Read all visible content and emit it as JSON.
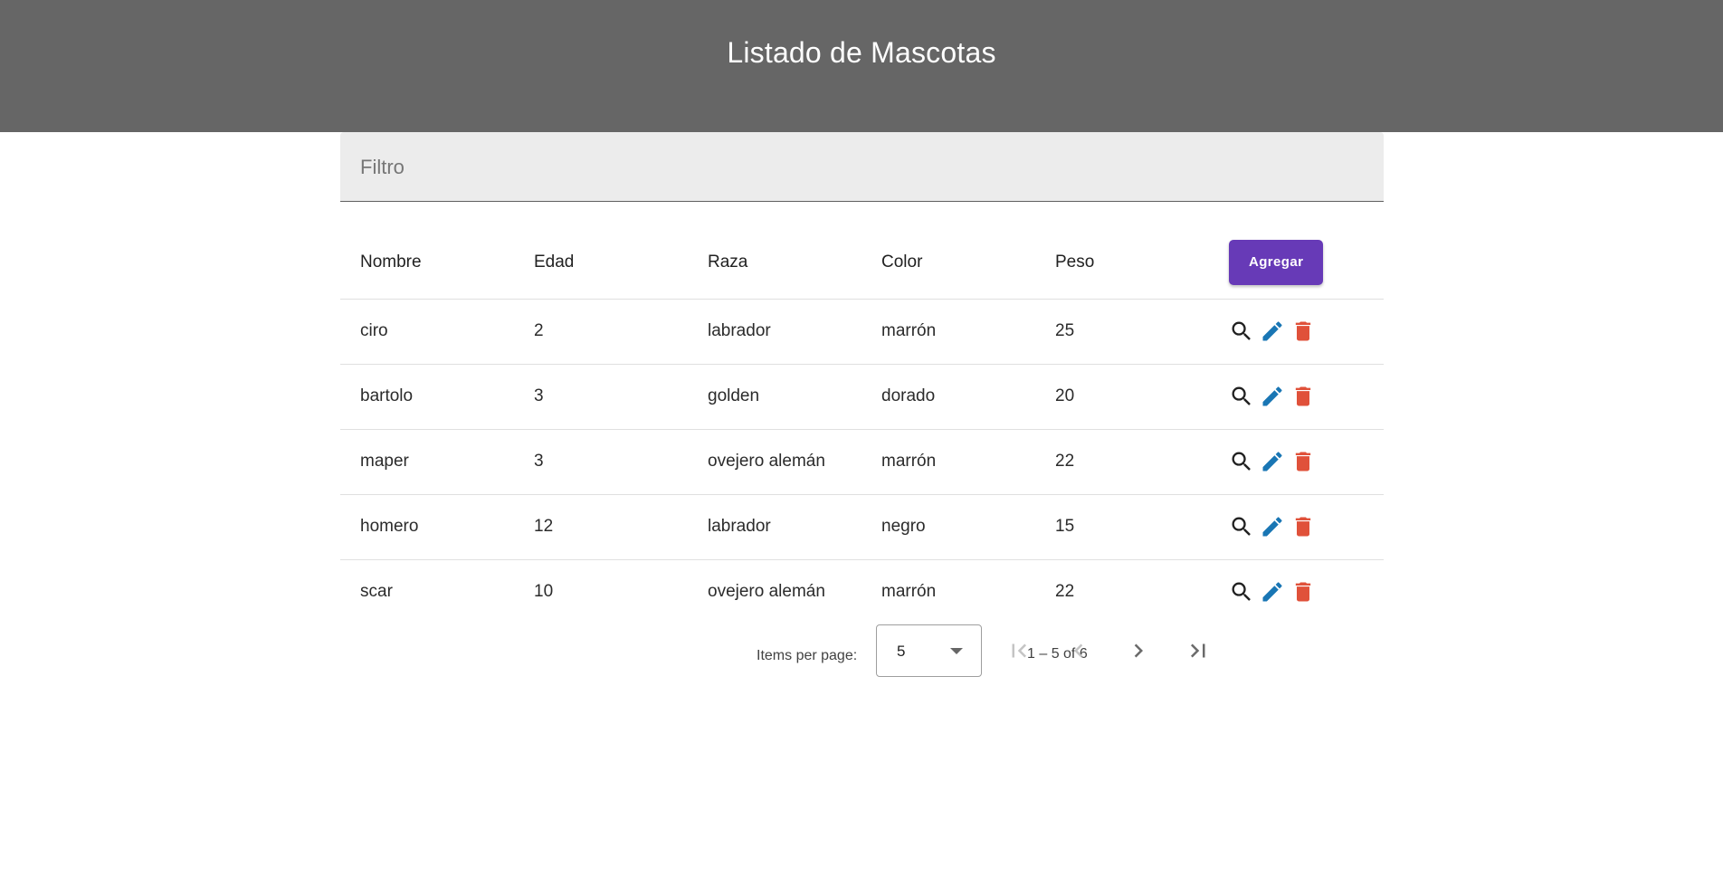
{
  "header": {
    "title": "Listado de Mascotas"
  },
  "filter": {
    "placeholder": "Filtro",
    "value": ""
  },
  "table": {
    "columns": [
      "Nombre",
      "Edad",
      "Raza",
      "Color",
      "Peso"
    ],
    "add_label": "Agregar",
    "rows": [
      [
        "ciro",
        "2",
        "labrador",
        "marrón",
        "25"
      ],
      [
        "bartolo",
        "3",
        "golden",
        "dorado",
        "20"
      ],
      [
        "maper",
        "3",
        "ovejero alemán",
        "marrón",
        "22"
      ],
      [
        "homero",
        "12",
        "labrador",
        "negro",
        "15"
      ],
      [
        "scar",
        "10",
        "ovejero alemán",
        "marrón",
        "22"
      ]
    ],
    "row_actions": [
      "search-icon",
      "edit-icon",
      "delete-icon"
    ]
  },
  "paginator": {
    "items_per_page_label": "Items per page:",
    "page_size": "5",
    "range_label": "1 – 5 of 6",
    "nav": [
      "first-page-icon",
      "previous-page-icon",
      "next-page-icon",
      "last-page-icon"
    ]
  },
  "colors": {
    "header_bg": "#666666",
    "accent": "#673ab7",
    "edit": "#1976b4",
    "delete": "#e0513a"
  }
}
